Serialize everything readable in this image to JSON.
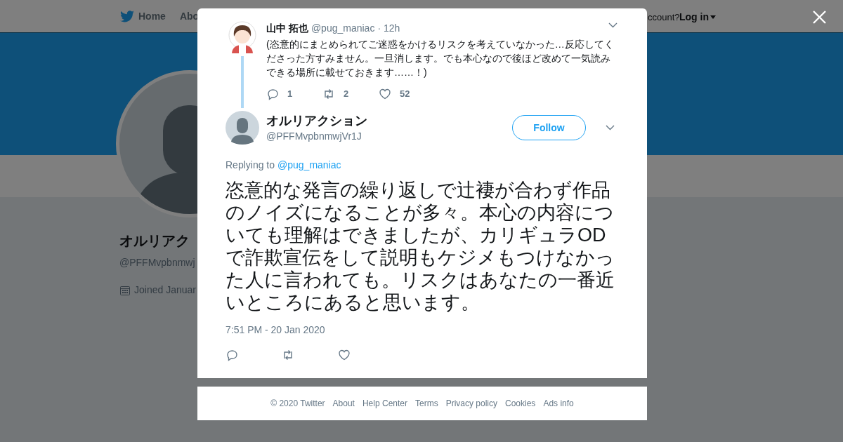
{
  "background": {
    "nav": [
      {
        "label": "Home",
        "kind": "home"
      },
      {
        "label": "Abo",
        "kind": "link"
      }
    ],
    "account_prompt": "ccount?",
    "login": "Log in",
    "profile": {
      "name": "オルリアク",
      "handle": "@PFFMvpbnmwj",
      "joined": "Joined Januar"
    }
  },
  "modal": {
    "parent_tweet": {
      "name": "山中 拓也",
      "handle": "@pug_maniac",
      "time": "· 12h",
      "text": "(恣意的にまとめられてご迷惑をかけるリスクを考えていなかった…反応してくださった方すみません。一旦消します。でも本心なので後ほど改めて一気読みできる場所に載せておきます……！)",
      "replies": "1",
      "retweets": "2",
      "likes": "52"
    },
    "tweet": {
      "name": "オルリアクション",
      "handle": "@PFFMvpbnmwjVr1J",
      "follow": "Follow",
      "replying_label": "Replying to",
      "replying_to": "@pug_maniac",
      "text": "恣意的な発言の繰り返しで辻褄が合わず作品のノイズになることが多々。本心の内容についても理解はできましたが、カリギュラODで詐欺宣伝をして説明もケジメもつけなかった人に言われても。リスクはあなたの一番近いところにあると思います。",
      "timestamp": "7:51 PM - 20 Jan 2020"
    }
  },
  "footer": [
    "© 2020 Twitter",
    "About",
    "Help Center",
    "Terms",
    "Privacy policy",
    "Cookies",
    "Ads info"
  ]
}
